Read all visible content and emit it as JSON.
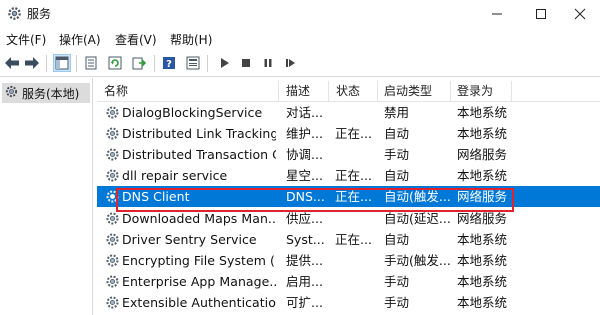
{
  "window": {
    "title": "服务",
    "controls": [
      "minimize",
      "maximize",
      "close"
    ]
  },
  "menu": [
    {
      "label": "文件(F)"
    },
    {
      "label": "操作(A)"
    },
    {
      "label": "查看(V)"
    },
    {
      "label": "帮助(H)"
    }
  ],
  "toolbar": {
    "buttons": [
      "back-icon",
      "forward-icon",
      "console-tree-icon",
      "properties-icon",
      "refresh-icon",
      "export-list-icon",
      "help-icon",
      "view-icon",
      "start-service-icon",
      "stop-service-icon",
      "pause-service-icon",
      "restart-service-icon"
    ]
  },
  "tree": {
    "selected_label": "服务(本地)"
  },
  "table": {
    "columns": [
      "名称",
      "描述",
      "状态",
      "启动类型",
      "登录为"
    ],
    "rows": [
      {
        "name": "DialogBlockingService",
        "desc": "对话...",
        "status": "",
        "start": "禁用",
        "logon": "本地系统"
      },
      {
        "name": "Distributed Link Tracking...",
        "desc": "维护...",
        "status": "正在...",
        "start": "自动",
        "logon": "本地系统"
      },
      {
        "name": "Distributed Transaction C...",
        "desc": "协调...",
        "status": "",
        "start": "手动",
        "logon": "网络服务"
      },
      {
        "name": "dll repair service",
        "desc": "星空...",
        "status": "正在...",
        "start": "自动",
        "logon": "本地系统"
      },
      {
        "name": "DNS Client",
        "desc": "DNS...",
        "status": "正在...",
        "start": "自动(触发...",
        "logon": "网络服务"
      },
      {
        "name": "Downloaded Maps Man...",
        "desc": "供应...",
        "status": "",
        "start": "自动(延迟...",
        "logon": "网络服务"
      },
      {
        "name": "Driver Sentry Service",
        "desc": "Syst...",
        "status": "正在...",
        "start": "自动",
        "logon": "本地系统"
      },
      {
        "name": "Encrypting File System (E...",
        "desc": "提供...",
        "status": "",
        "start": "手动(触发...",
        "logon": "本地系统"
      },
      {
        "name": "Enterprise App Manage...",
        "desc": "启用...",
        "status": "",
        "start": "手动",
        "logon": "本地系统"
      },
      {
        "name": "Extensible Authentication...",
        "desc": "可扩...",
        "status": "",
        "start": "手动",
        "logon": "本地系统"
      }
    ],
    "selected_row": "DNS Client"
  },
  "colors": {
    "selection": "#0078d7",
    "highlight_outline": "#e0242f"
  }
}
